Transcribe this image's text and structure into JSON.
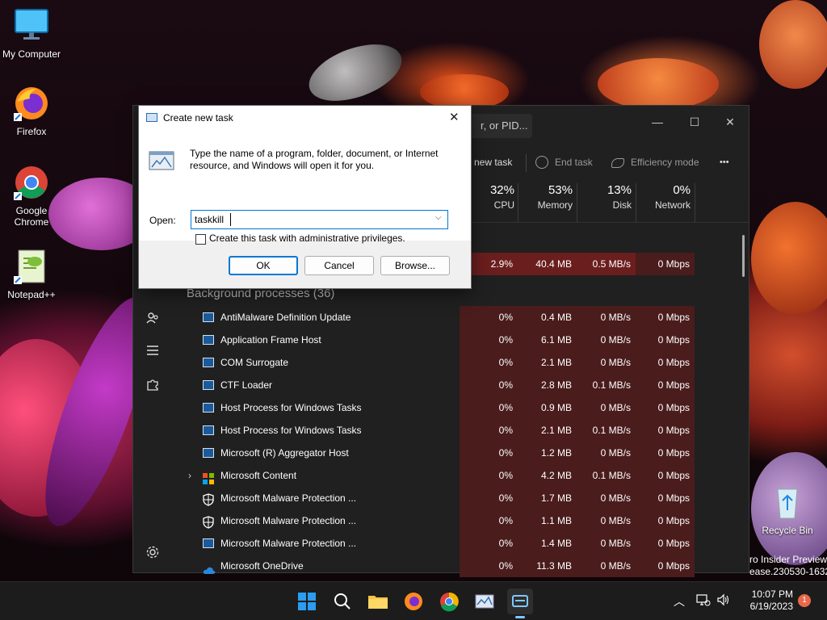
{
  "desktop": {
    "icons": [
      {
        "label": "My Computer"
      },
      {
        "label": "Firefox"
      },
      {
        "label": "Google Chrome"
      },
      {
        "label": "Notepad++"
      },
      {
        "label": "Recycle Bin"
      }
    ],
    "watermark_line1": "ro Insider Preview",
    "watermark_line2": "ease.230530-1632"
  },
  "task_manager": {
    "search_placeholder": "r, or PID...",
    "commands": {
      "run_new_task": "new task",
      "end_task": "End task",
      "efficiency_mode": "Efficiency mode",
      "more": "•••"
    },
    "columns": [
      {
        "pct": "32%",
        "label": "CPU"
      },
      {
        "pct": "53%",
        "label": "Memory"
      },
      {
        "pct": "13%",
        "label": "Disk"
      },
      {
        "pct": "0%",
        "label": "Network"
      }
    ],
    "top_row": {
      "cpu": "2.9%",
      "memory": "40.4 MB",
      "disk": "0.5 MB/s",
      "network": "0 Mbps"
    },
    "group_title": "Background processes (36)",
    "processes": [
      {
        "name": "AntiMalware Definition Update",
        "cpu": "0%",
        "memory": "0.4 MB",
        "disk": "0 MB/s",
        "network": "0 Mbps",
        "icon": "window-icon"
      },
      {
        "name": "Application Frame Host",
        "cpu": "0%",
        "memory": "6.1 MB",
        "disk": "0 MB/s",
        "network": "0 Mbps",
        "icon": "window-icon"
      },
      {
        "name": "COM Surrogate",
        "cpu": "0%",
        "memory": "2.1 MB",
        "disk": "0 MB/s",
        "network": "0 Mbps",
        "icon": "window-icon"
      },
      {
        "name": "CTF Loader",
        "cpu": "0%",
        "memory": "2.8 MB",
        "disk": "0.1 MB/s",
        "network": "0 Mbps",
        "icon": "window-icon"
      },
      {
        "name": "Host Process for Windows Tasks",
        "cpu": "0%",
        "memory": "0.9 MB",
        "disk": "0 MB/s",
        "network": "0 Mbps",
        "icon": "window-icon"
      },
      {
        "name": "Host Process for Windows Tasks",
        "cpu": "0%",
        "memory": "2.1 MB",
        "disk": "0.1 MB/s",
        "network": "0 Mbps",
        "icon": "window-icon"
      },
      {
        "name": "Microsoft (R) Aggregator Host",
        "cpu": "0%",
        "memory": "1.2 MB",
        "disk": "0 MB/s",
        "network": "0 Mbps",
        "icon": "window-icon"
      },
      {
        "name": "Microsoft Content",
        "cpu": "0%",
        "memory": "4.2 MB",
        "disk": "0.1 MB/s",
        "network": "0 Mbps",
        "icon": "windows-logo-icon"
      },
      {
        "name": "Microsoft Malware Protection ...",
        "cpu": "0%",
        "memory": "1.7 MB",
        "disk": "0 MB/s",
        "network": "0 Mbps",
        "icon": "shield-icon"
      },
      {
        "name": "Microsoft Malware Protection ...",
        "cpu": "0%",
        "memory": "1.1 MB",
        "disk": "0 MB/s",
        "network": "0 Mbps",
        "icon": "shield-icon"
      },
      {
        "name": "Microsoft Malware Protection ...",
        "cpu": "0%",
        "memory": "1.4 MB",
        "disk": "0 MB/s",
        "network": "0 Mbps",
        "icon": "window-icon"
      },
      {
        "name": "Microsoft OneDrive",
        "cpu": "0%",
        "memory": "11.3 MB",
        "disk": "0 MB/s",
        "network": "0 Mbps",
        "icon": "cloud-icon"
      }
    ],
    "colors": {
      "cell_dark": "#4a1c1c",
      "cell_highlight": "#6b1e1e"
    }
  },
  "dialog": {
    "title": "Create new task",
    "description": "Type the name of a program, folder, document, or Internet resource, and Windows will open it for you.",
    "open_label": "Open:",
    "open_value": "taskkill",
    "admin_label": "Create this task with administrative privileges.",
    "admin_checked": false,
    "ok": "OK",
    "cancel": "Cancel",
    "browse": "Browse..."
  },
  "taskbar": {
    "time": "10:07 PM",
    "date": "6/19/2023",
    "notification_count": "1",
    "accent": "#0078d4"
  }
}
